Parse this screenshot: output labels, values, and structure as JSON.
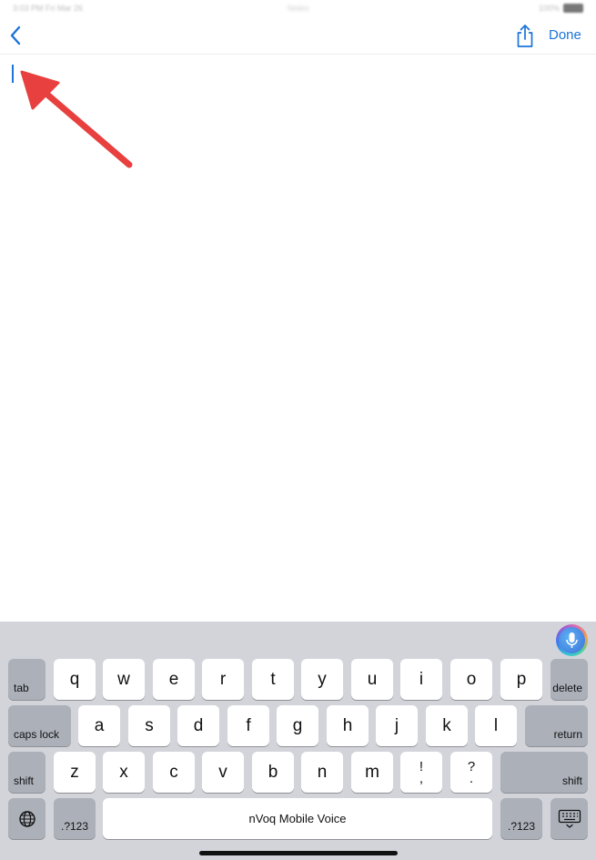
{
  "status_bar": {
    "time": "3:03 PM  Fri Mar 26",
    "center": "Notes",
    "right": "100%"
  },
  "nav": {
    "done_label": "Done"
  },
  "keyboard": {
    "row1": [
      "q",
      "w",
      "e",
      "r",
      "t",
      "y",
      "u",
      "i",
      "o",
      "p"
    ],
    "row2": [
      "a",
      "s",
      "d",
      "f",
      "g",
      "h",
      "j",
      "k",
      "l"
    ],
    "row3": [
      "z",
      "x",
      "c",
      "v",
      "b",
      "n",
      "m"
    ],
    "tab_label": "tab",
    "delete_label": "delete",
    "caps_lock_label": "caps lock",
    "return_label": "return",
    "shift_label": "shift",
    "shift_right_label": "shift",
    "punct1_top": "!",
    "punct1_bottom": ",",
    "punct2_top": "?",
    "punct2_bottom": ".",
    "numbers_left_label": ".?123",
    "numbers_right_label": ".?123",
    "space_label": "nVoq Mobile Voice"
  },
  "icons": [
    "back-chevron-icon",
    "share-icon",
    "microphone-icon",
    "globe-icon",
    "keyboard-dismiss-icon",
    "annotation-arrow"
  ],
  "colors": {
    "accent": "#1a74d9",
    "keyboard_bg": "#d2d4da",
    "annotation": "#e8403f"
  }
}
